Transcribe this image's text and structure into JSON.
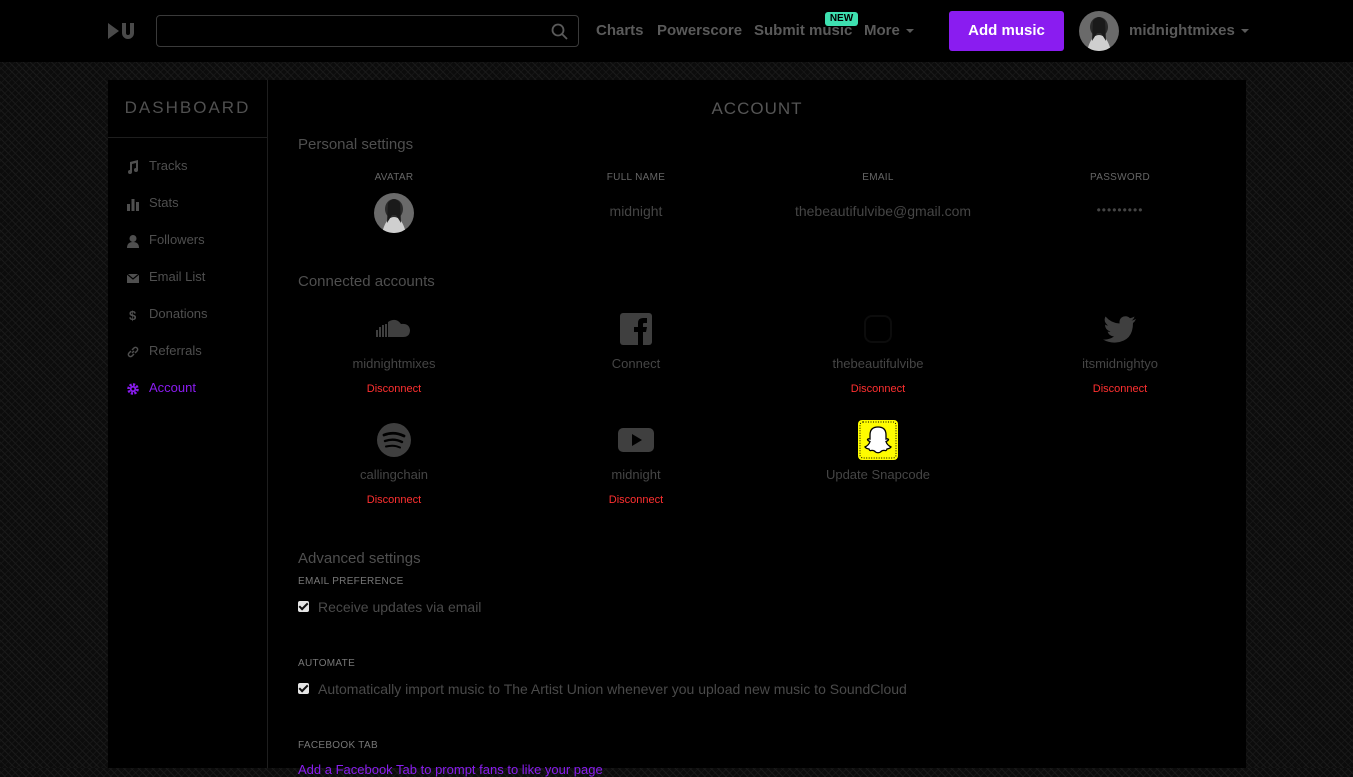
{
  "header": {
    "search_placeholder": "",
    "nav": {
      "charts": "Charts",
      "powerscore": "Powerscore",
      "submit_music": "Submit music",
      "new_badge": "NEW",
      "more": "More"
    },
    "add_music": "Add music",
    "username": "midnightmixes",
    "accent_color": "#8a1cf0",
    "badge_color": "#3ee0b0"
  },
  "sidebar": {
    "title": "DASHBOARD",
    "items": [
      {
        "label": "Tracks",
        "icon": "music-note-icon"
      },
      {
        "label": "Stats",
        "icon": "bar-chart-icon"
      },
      {
        "label": "Followers",
        "icon": "user-icon"
      },
      {
        "label": "Email List",
        "icon": "envelope-icon"
      },
      {
        "label": "Donations",
        "icon": "dollar-icon"
      },
      {
        "label": "Referrals",
        "icon": "link-icon"
      },
      {
        "label": "Account",
        "icon": "gear-icon",
        "active": true
      }
    ]
  },
  "account": {
    "title": "ACCOUNT",
    "personal": {
      "heading": "Personal settings",
      "avatar_label": "AVATAR",
      "fullname_label": "FULL NAME",
      "fullname": "midnight",
      "email_label": "EMAIL",
      "email": "thebeautifulvibe@gmail.com",
      "password_label": "PASSWORD",
      "password": "•••••••••"
    },
    "connected": {
      "heading": "Connected accounts",
      "accounts": [
        {
          "service": "soundcloud-icon",
          "name": "midnightmixes",
          "action": "Disconnect"
        },
        {
          "service": "facebook-icon",
          "name": "Connect",
          "action": ""
        },
        {
          "service": "instagram-icon",
          "name": "thebeautifulvibe",
          "action": "Disconnect"
        },
        {
          "service": "twitter-icon",
          "name": "itsmidnightyo",
          "action": "Disconnect"
        },
        {
          "service": "spotify-icon",
          "name": "callingchain",
          "action": "Disconnect"
        },
        {
          "service": "youtube-icon",
          "name": "midnight",
          "action": "Disconnect"
        },
        {
          "service": "snapchat-icon",
          "name": "Update Snapcode",
          "action": ""
        }
      ],
      "disconnect_color": "#ff3030"
    },
    "advanced": {
      "heading": "Advanced settings",
      "email_pref_label": "EMAIL PREFERENCE",
      "email_pref_text": "Receive updates via email",
      "email_pref_checked": true,
      "automate_label": "AUTOMATE",
      "automate_text": "Automatically import music to The Artist Union whenever you upload new music to SoundCloud",
      "automate_checked": true,
      "facebook_tab_label": "FACEBOOK TAB",
      "facebook_tab_link": "Add a Facebook Tab to prompt fans to like your page"
    }
  }
}
